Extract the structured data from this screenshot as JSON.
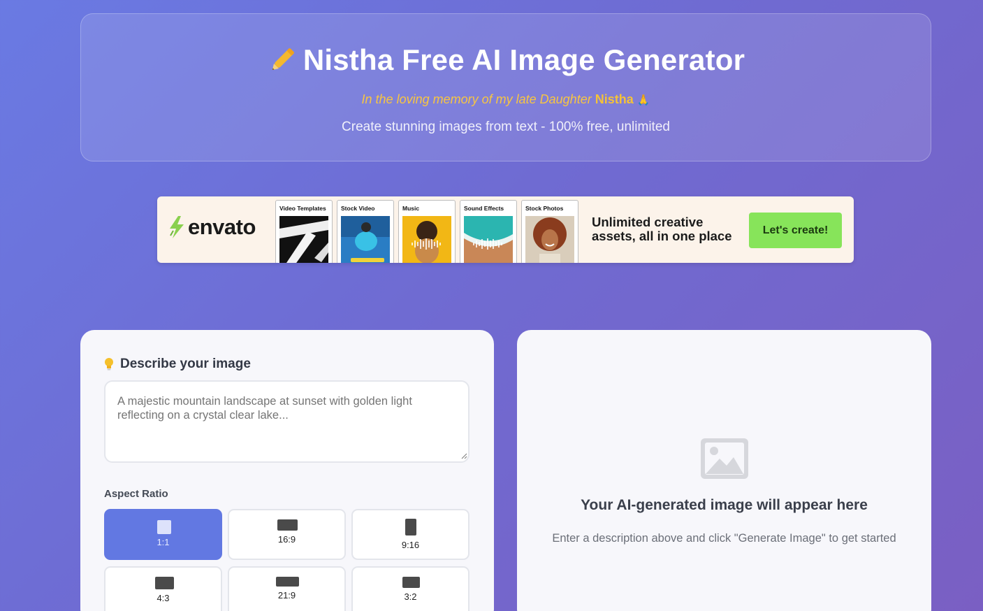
{
  "header": {
    "title": "Nistha Free AI Image Generator",
    "title_icon": "pencil-icon",
    "memory_prefix": "In the loving memory of my late Daughter",
    "memory_name": "Nistha",
    "memory_emoji": "🙏",
    "subtitle": "Create stunning images from text - 100% free, unlimited"
  },
  "banner": {
    "brand": "envato",
    "tiles": [
      "Video Templates",
      "Stock Video",
      "Music",
      "Sound Effects",
      "Stock Photos"
    ],
    "copy_line1": "Unlimited creative",
    "copy_line2": "assets, all in one place",
    "cta": "Let's create!",
    "accent_color": "#87e45a"
  },
  "prompt_section": {
    "title": "Describe your image",
    "icon": "lightbulb-icon",
    "placeholder": "A majestic mountain landscape at sunset with golden light reflecting on a crystal clear lake...",
    "value": ""
  },
  "aspect_ratio": {
    "label": "Aspect Ratio",
    "selected": "1:1",
    "options": [
      "1:1",
      "16:9",
      "9:16",
      "4:3",
      "21:9",
      "3:2"
    ],
    "active_color": "#6278e2"
  },
  "preview": {
    "icon": "image-icon",
    "title": "Your AI-generated image will appear here",
    "description": "Enter a description above and click \"Generate Image\" to get started"
  }
}
